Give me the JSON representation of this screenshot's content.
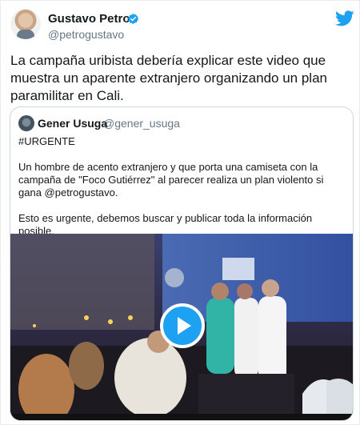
{
  "tweet": {
    "author_name": "Gustavo Petro",
    "author_handle": "@petrogustavo",
    "text": "La campaña uribista debería explicar este video que muestra un aparente extranjero organizando un plan paramilitar en Cali."
  },
  "quoted_tweet": {
    "author_name": "Gener Usuga",
    "author_handle": "@gener_usuga",
    "lines": [
      "#URGENTE",
      "Un hombre de acento extranjero y que porta una camiseta con la campaña de  \"Foco Gutiérrez\" al parecer realiza un plan violento si gana @petrogustavo.",
      "Esto es urgente, debemos buscar y publicar toda la información posible."
    ]
  },
  "icons": {
    "verified": "verified-badge-icon",
    "brand": "twitter-bird-icon",
    "play": "play-icon"
  },
  "colors": {
    "brand": "#1da1f2",
    "text": "#14171a",
    "secondary": "#657786",
    "border": "#ccd6dd"
  }
}
